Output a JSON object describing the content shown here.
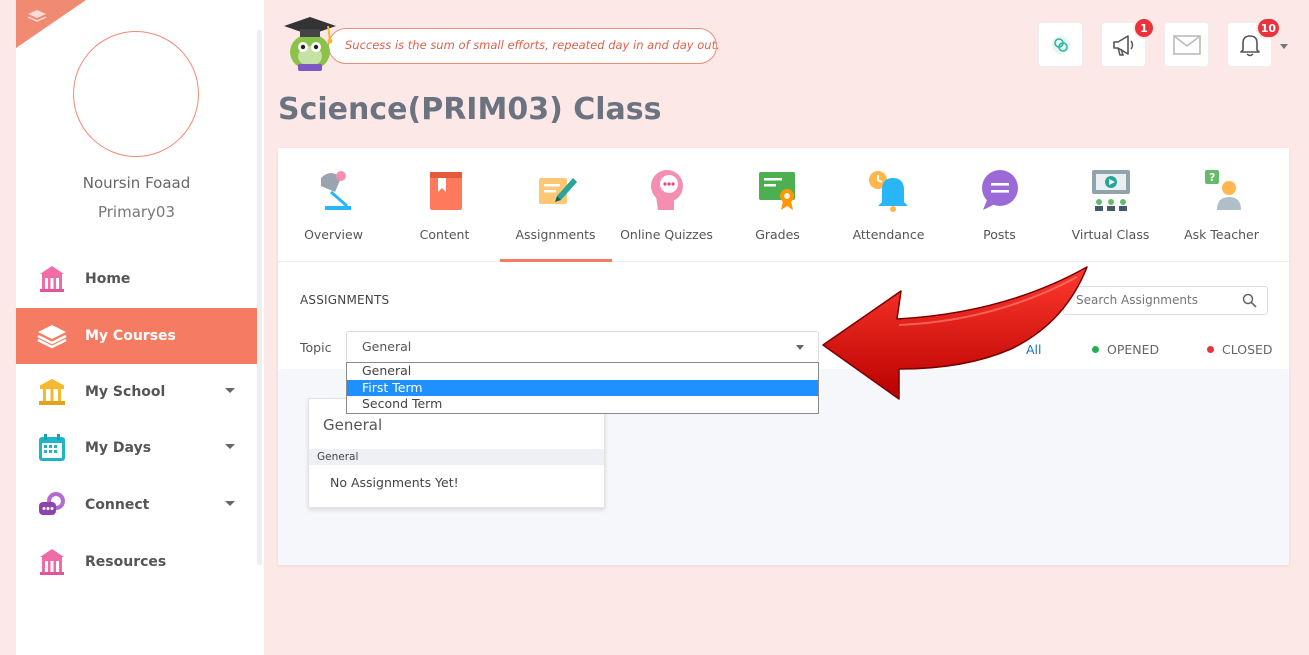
{
  "user": {
    "name": "Noursin Foaad",
    "class": "Primary03"
  },
  "sidebar": {
    "items": [
      {
        "label": "Home",
        "icon": "school-house-icon",
        "active": false,
        "expandable": false
      },
      {
        "label": "My Courses",
        "icon": "books-stack-icon",
        "active": true,
        "expandable": false
      },
      {
        "label": "My School",
        "icon": "building-columns-icon",
        "active": false,
        "expandable": true
      },
      {
        "label": "My Days",
        "icon": "calendar-icon",
        "active": false,
        "expandable": true
      },
      {
        "label": "Connect",
        "icon": "chat-bubble-icon",
        "active": false,
        "expandable": true
      },
      {
        "label": "Resources",
        "icon": "school-house-icon",
        "active": false,
        "expandable": false
      }
    ]
  },
  "header": {
    "quote": "Success is the sum of small efforts, repeated day in and day out.",
    "announcements_count": "1",
    "notifications_count": "10"
  },
  "page": {
    "title": "Science(PRIM03) Class"
  },
  "tabs": [
    {
      "label": "Overview",
      "icon": "desk-lamp-icon"
    },
    {
      "label": "Content",
      "icon": "book-icon"
    },
    {
      "label": "Assignments",
      "icon": "assignment-pen-icon",
      "active": true
    },
    {
      "label": "Online Quizzes",
      "icon": "quiz-head-icon"
    },
    {
      "label": "Grades",
      "icon": "certificate-icon"
    },
    {
      "label": "Attendance",
      "icon": "alarm-bell-icon"
    },
    {
      "label": "Posts",
      "icon": "speech-bubble-icon"
    },
    {
      "label": "Virtual Class",
      "icon": "video-class-icon"
    },
    {
      "label": "Ask Teacher",
      "icon": "question-person-icon"
    }
  ],
  "assignments": {
    "heading": "ASSIGNMENTS",
    "search_placeholder": "Search Assignments",
    "topic_label": "Topic",
    "topic_selected": "General",
    "topic_options": [
      "General",
      "First Term",
      "Second Term"
    ],
    "highlighted_option": "First Term",
    "filters": {
      "all": "All",
      "opened": "OPENED",
      "closed": "CLOSED"
    },
    "colors": {
      "opened": "#22b14c",
      "closed": "#e8333c"
    },
    "card": {
      "title": "General",
      "subtitle": "General",
      "empty_text": "No Assignments Yet!"
    }
  },
  "colors": {
    "accent": "#f57c63",
    "background": "#fde8e8",
    "badge": "#e8333c"
  }
}
